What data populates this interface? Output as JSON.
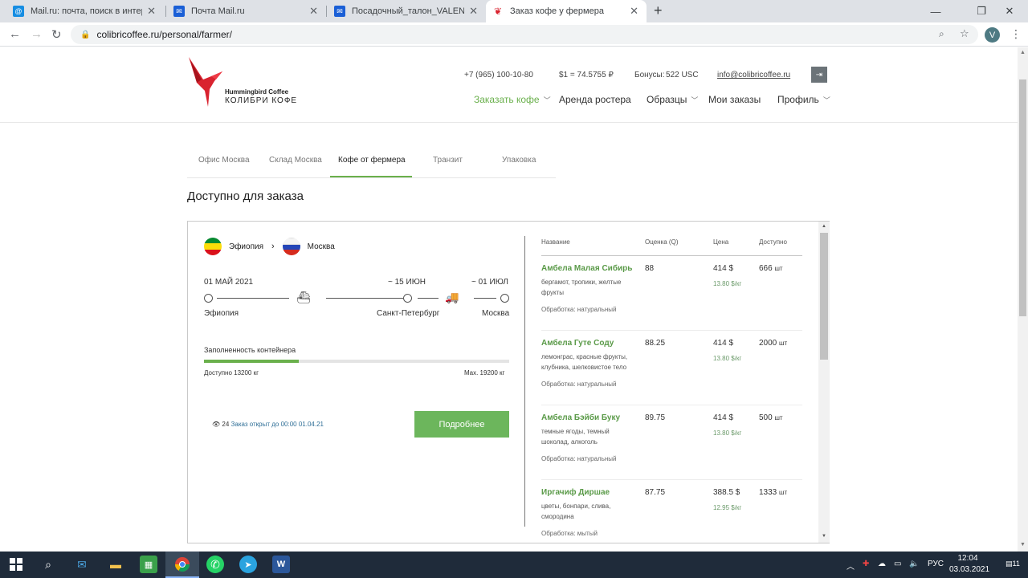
{
  "browser": {
    "tabs": [
      {
        "title": "Mail.ru: почта, поиск в интернете",
        "icon": "mailru-icon"
      },
      {
        "title": "Почта Mail.ru",
        "icon": "mail-icon"
      },
      {
        "title": "Посадочный_талон_VALENTINA",
        "icon": "mail-icon"
      },
      {
        "title": "Заказ кофе у фермера",
        "icon": "hummingbird-icon",
        "active": true
      }
    ],
    "url": "colibricoffee.ru/personal/farmer/",
    "profile_initial": "V"
  },
  "site": {
    "logo_line1": "Hummingbird Coffee",
    "logo_line2": "КОЛИБРИ КОФЕ",
    "phone": "+7 (965) 100-10-80",
    "rate": "$1 = 74.5755 ₽",
    "bonus_label": "Бонусы:",
    "bonus_value": "522 USC",
    "email": "info@colibricoffee.ru",
    "nav": [
      {
        "label": "Заказать кофе",
        "dropdown": true,
        "active": true
      },
      {
        "label": "Аренда ростера",
        "dropdown": false
      },
      {
        "label": "Образцы",
        "dropdown": true
      },
      {
        "label": "Мои заказы",
        "dropdown": false
      },
      {
        "label": "Профиль",
        "dropdown": true
      }
    ],
    "accent_color": "#6ab04c"
  },
  "subtabs": [
    {
      "label": "Офис Москва"
    },
    {
      "label": "Склад Москва"
    },
    {
      "label": "Кофе от фермера",
      "active": true
    },
    {
      "label": "Транзит"
    },
    {
      "label": "Упаковка"
    }
  ],
  "section_title": "Доступно для заказа",
  "shipment": {
    "origin": "Эфиопия",
    "destination": "Москва",
    "date_start": "01 МАЙ 2021",
    "date_mid": "~ 15 ИЮН",
    "date_end": "~ 01 ИЮЛ",
    "city_start": "Эфиопия",
    "city_mid": "Санкт-Петербург",
    "city_end": "Москва",
    "fill_label": "Заполненность контейнера",
    "fill_fraction": 0.31,
    "available": "Доступно 13200 кг",
    "max": "Max. 19200 кг",
    "views": "24",
    "open_until": "Заказ открыт до 00:00 01.04.21",
    "details_button": "Подробнее"
  },
  "table": {
    "headers": {
      "name": "Название",
      "score": "Оценка (Q)",
      "price": "Цена",
      "stock": "Доступно"
    },
    "rows": [
      {
        "name": "Амбела Малая Сибирь",
        "notes": "бергамот, тропики, желтые фрукты",
        "process": "Обработка: натуральный",
        "score": "88",
        "price": "414 $",
        "per_kg": "13.80 $/кг",
        "stock": "666",
        "unit": "шт"
      },
      {
        "name": "Амбела Гуте Соду",
        "notes": "лемонграс, красные фрукты, клубника, шелковистое тело",
        "process": "Обработка: натуральный",
        "score": "88.25",
        "price": "414 $",
        "per_kg": "13.80 $/кг",
        "stock": "2000",
        "unit": "шт"
      },
      {
        "name": "Амбела Бэйби Буку",
        "notes": "темные ягоды, темный шоколад, алкоголь",
        "process": "Обработка: натуральный",
        "score": "89.75",
        "price": "414 $",
        "per_kg": "13.80 $/кг",
        "stock": "500",
        "unit": "шт"
      },
      {
        "name": "Иргачиф Диршае",
        "notes": "цветы, бонпари, слива, смородина",
        "process": "Обработка: мытый",
        "score": "87.75",
        "price": "388.5 $",
        "per_kg": "12.95 $/кг",
        "stock": "1333",
        "unit": "шт"
      }
    ]
  },
  "taskbar": {
    "language": "РУС",
    "time": "12:04",
    "date": "03.03.2021",
    "notification_count": "11"
  }
}
